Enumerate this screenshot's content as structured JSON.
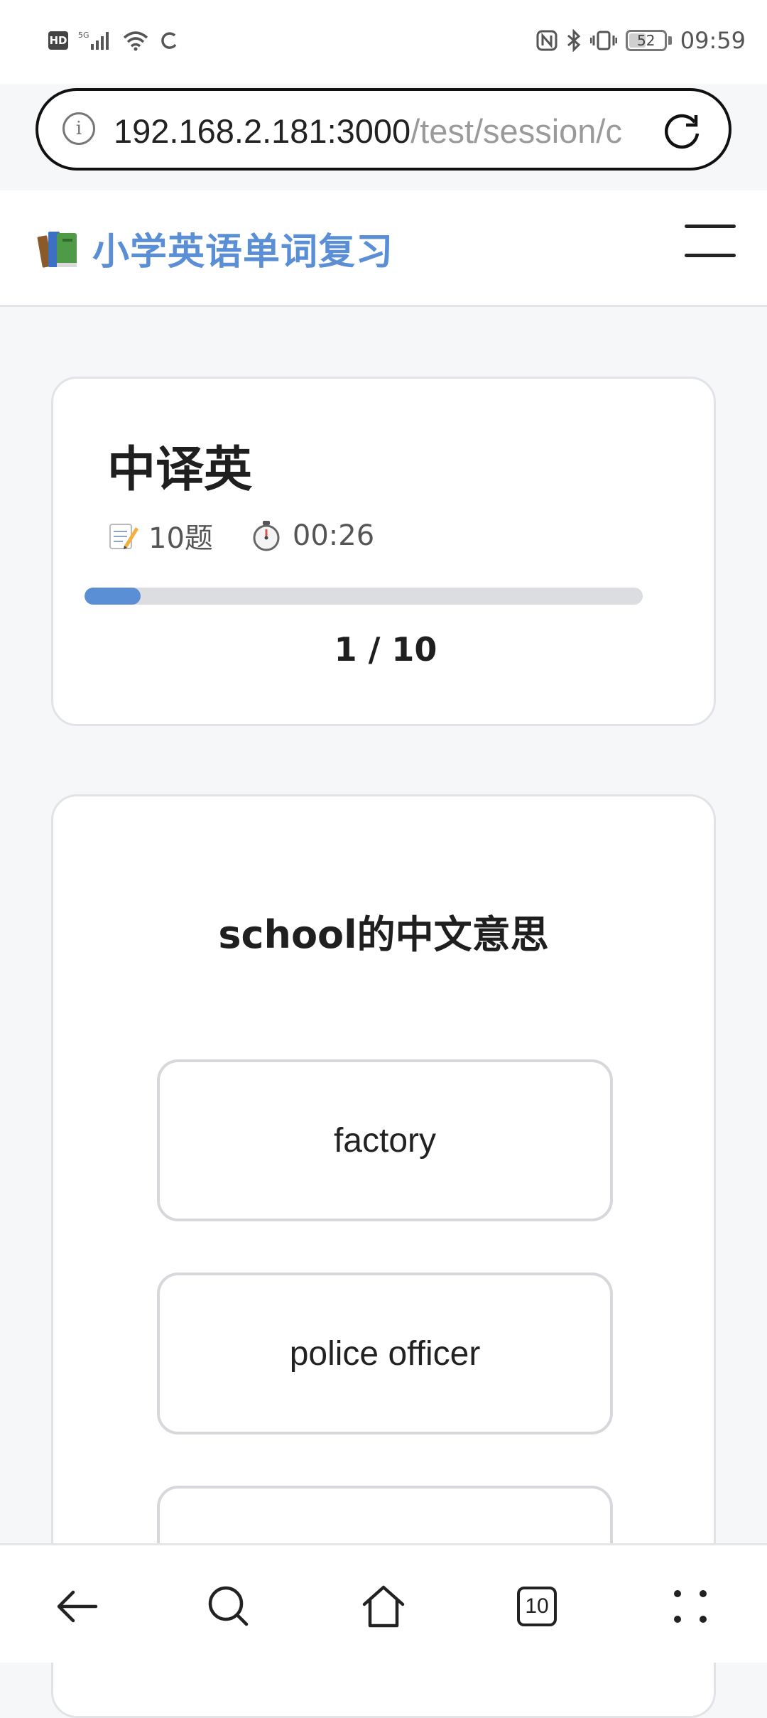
{
  "status_bar": {
    "hd_label": "HD",
    "signal_label": "5G",
    "battery_level": "52",
    "time": "09:59"
  },
  "browser": {
    "url_host": "192.168.2.181:3000",
    "url_path": "/test/session/c",
    "tab_count": "10"
  },
  "site": {
    "title": "小学英语单词复习",
    "logo_icon": "books-icon"
  },
  "test": {
    "title": "中译英",
    "question_count_label": "10题",
    "timer": "00:26",
    "progress_label": "1 / 10",
    "progress_fraction": 0.1
  },
  "question": {
    "prompt": "school的中文意思",
    "options": [
      "factory",
      "police officer",
      ""
    ]
  },
  "colors": {
    "accent": "#5a8fd6",
    "progress_track": "#dcdde0"
  }
}
